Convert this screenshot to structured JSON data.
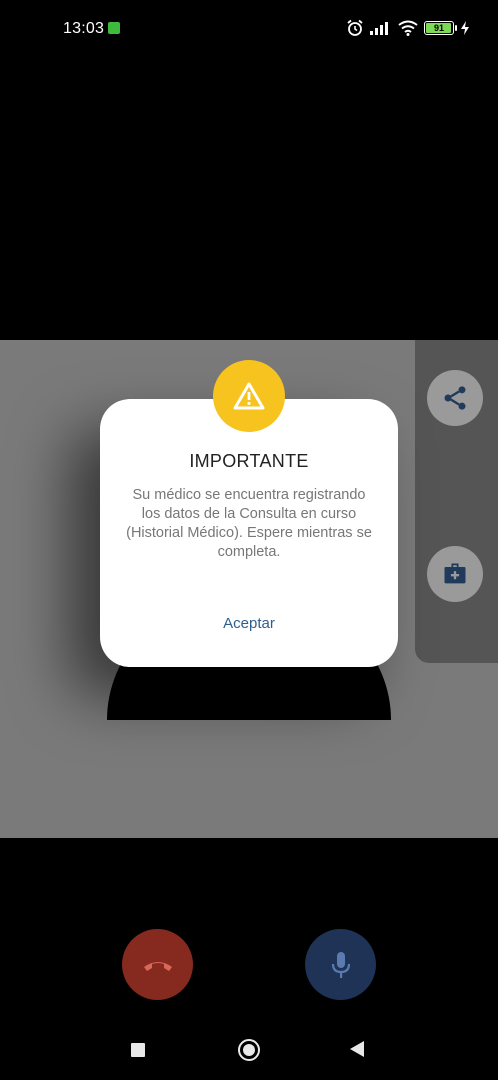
{
  "status_bar": {
    "time": "13:03",
    "battery": "91"
  },
  "dialog": {
    "title": "IMPORTANTE",
    "message": "Su médico se encuentra registrando los datos de la Consulta en curso (Historial Médico). Espere mientras se completa.",
    "action_label": "Aceptar"
  },
  "icons": {
    "warning": "warning-icon",
    "share": "share-icon",
    "medical": "medical-kit-icon",
    "hangup": "hangup-icon",
    "mic": "microphone-icon"
  },
  "colors": {
    "warning": "#f7c31f",
    "hangup": "#862a1f",
    "mic": "#1e3355",
    "accent_link": "#2c5f8f"
  }
}
